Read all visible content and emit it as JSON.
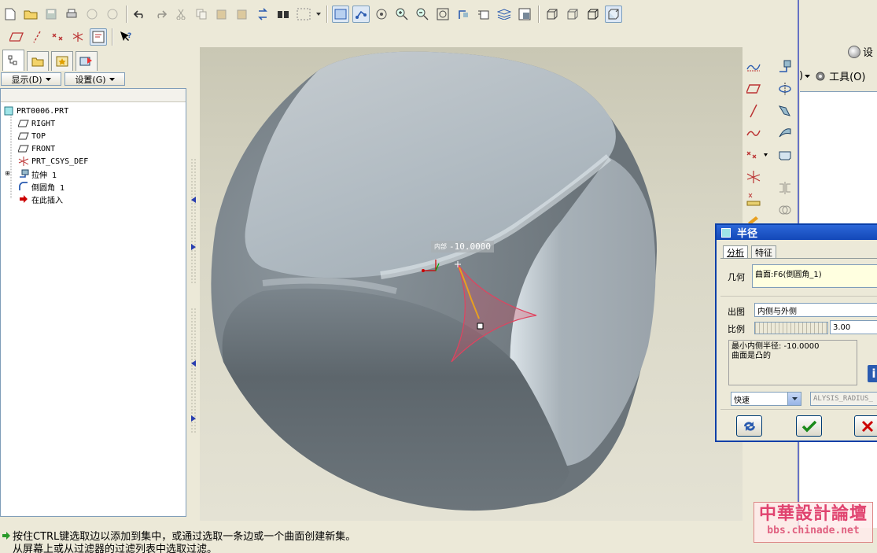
{
  "tree": {
    "root": "PRT0006.PRT",
    "items": [
      "RIGHT",
      "TOP",
      "FRONT",
      "PRT_CSYS_DEF",
      "拉伸 1",
      "倒圆角 1",
      "在此插入"
    ]
  },
  "navbar": {
    "show_label": "显示(D)",
    "settings_label": "设置(G)"
  },
  "farright": {
    "settings_fragment": "设",
    "tools_label": "工具(O)"
  },
  "viewport": {
    "dim_prefix": "内部",
    "dim_value": "-10.0000"
  },
  "dialog": {
    "title": "半径",
    "tab_analysis": "分析",
    "tab_feature": "特征",
    "geometry_label": "几何",
    "geometry_value": "曲面:F6(倒圆角_1)",
    "display_label": "出图",
    "display_value": "内侧与外侧",
    "scale_label": "比例",
    "scale_value": "3.00",
    "result_line1": "最小内侧半径: -10.0000",
    "result_line2": "曲面是凸的",
    "mode_value": "快速",
    "name_value": "ALYSIS_RADIUS_"
  },
  "status": {
    "line1": "按住CTRL键选取边以添加到集中，或通过选取一条边或一个曲面创建新集。",
    "line2": "从屏幕上或从过滤器的过滤列表中选取过滤。"
  },
  "watermark": {
    "title": "中華設計論壇",
    "url": "bbs.chinade.net"
  },
  "colors": {
    "accent": "#0a3fa8",
    "highlight": "#e0435f",
    "title_bar": "#2c67d8"
  }
}
